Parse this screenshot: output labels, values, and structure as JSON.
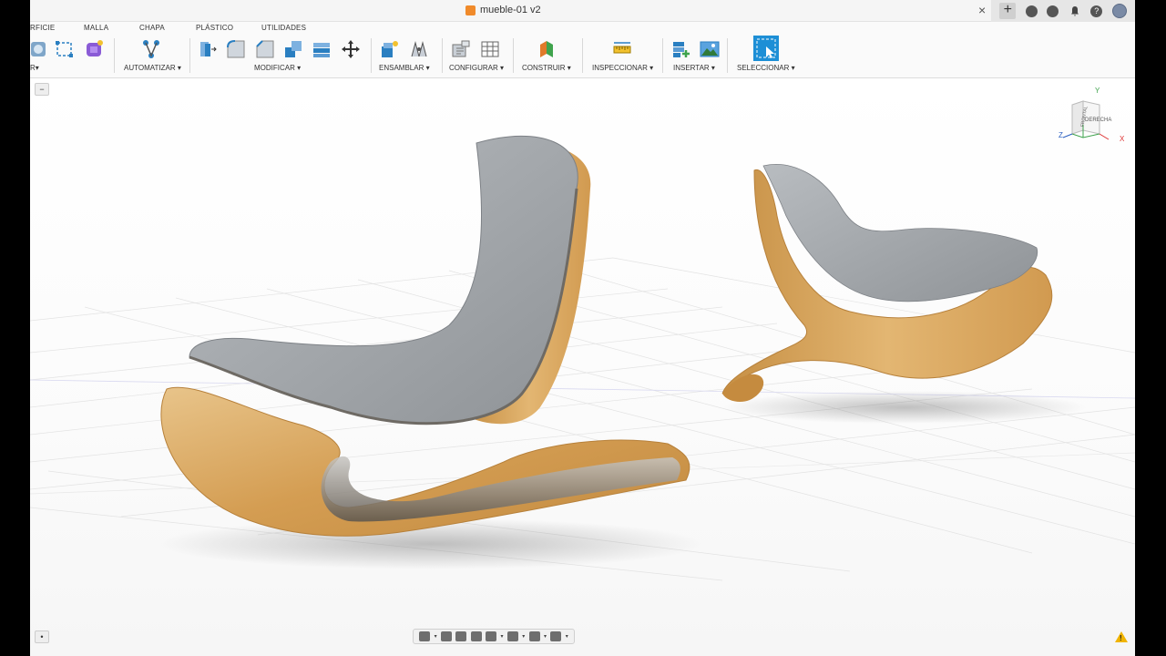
{
  "window": {
    "doc_title": "mueble-01 v2",
    "close_glyph": "×"
  },
  "ribbon": {
    "tabs": [
      {
        "label": "RFICIE"
      },
      {
        "label": "MALLA"
      },
      {
        "label": "CHAPA"
      },
      {
        "label": "PLÁSTICO"
      },
      {
        "label": "UTILIDADES"
      }
    ],
    "groups": [
      {
        "label": "R▾"
      },
      {
        "label": "AUTOMATIZAR ▾"
      },
      {
        "label": "MODIFICAR ▾"
      },
      {
        "label": "ENSAMBLAR ▾"
      },
      {
        "label": "CONFIGURAR ▾"
      },
      {
        "label": "CONSTRUIR ▾"
      },
      {
        "label": "INSPECCIONAR ▾"
      },
      {
        "label": "INSERTAR ▾"
      },
      {
        "label": "SELECCIONAR ▾"
      }
    ]
  },
  "viewcube": {
    "front": "FRONTAL",
    "right": "DERECHA",
    "axis_x": "X",
    "axis_y": "Y",
    "axis_z": "Z"
  },
  "viewport": {
    "collapse_glyph": "−",
    "settings_glyph": "•"
  },
  "icons": {
    "plus": "+",
    "help": "?",
    "warning": "!"
  },
  "colors": {
    "accent_blue": "#1d8fd6",
    "wood": "#d9a85c",
    "felt": "#9a9ea3",
    "warning": "#f0b400"
  }
}
